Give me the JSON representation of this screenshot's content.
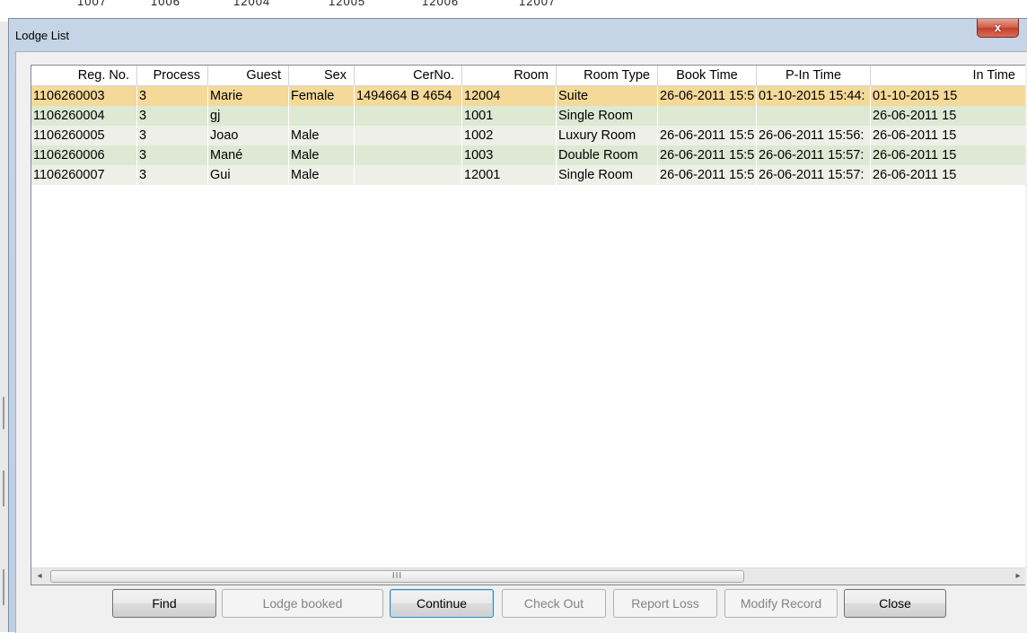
{
  "background": {
    "strip_fragments": [
      "1007",
      "1006",
      "12004",
      "12005",
      "12006",
      "12007"
    ]
  },
  "dialog": {
    "title": "Lodge List",
    "close_glyph": "x",
    "colors": {
      "selected_row": "#f4d998",
      "even_row": "#dde9d3",
      "odd_row": "#eef0e8",
      "title_bg": "#c5d4e6"
    }
  },
  "table": {
    "columns": [
      "Reg. No.",
      "Process",
      "Guest",
      "Sex",
      "CerNo.",
      "Room",
      "Room Type",
      "Book Time",
      "P-In Time",
      "In Time"
    ],
    "rows": [
      [
        "1106260003",
        "3",
        "Marie",
        "Female",
        "1494664 B 4654",
        "12004",
        "Suite",
        "26-06-2011 15:5",
        "01-10-2015 15:44:",
        "01-10-2015 15"
      ],
      [
        "1106260004",
        "3",
        "gj",
        "",
        "",
        "1001",
        "Single Room",
        "",
        "",
        "26-06-2011 15"
      ],
      [
        "1106260005",
        "3",
        "Joao",
        "Male",
        "",
        "1002",
        "Luxury Room",
        "26-06-2011 15:5",
        "26-06-2011 15:56:",
        "26-06-2011 15"
      ],
      [
        "1106260006",
        "3",
        "Mané",
        "Male",
        "",
        "1003",
        "Double Room",
        "26-06-2011 15:5",
        "26-06-2011 15:57:",
        "26-06-2011 15"
      ],
      [
        "1106260007",
        "3",
        "Gui",
        "Male",
        "",
        "12001",
        "Single Room",
        "26-06-2011 15:5",
        "26-06-2011 15:57:",
        "26-06-2011 15"
      ]
    ],
    "selected_row": 0
  },
  "scrollbar": {
    "left_arrow": "◂",
    "right_arrow": "▸",
    "grip": "III"
  },
  "buttons": {
    "find": "Find",
    "lodge_booked": "Lodge booked",
    "continue": "Continue",
    "check_out": "Check Out",
    "report_loss": "Report Loss",
    "modify_record": "Modify Record",
    "close": "Close"
  }
}
